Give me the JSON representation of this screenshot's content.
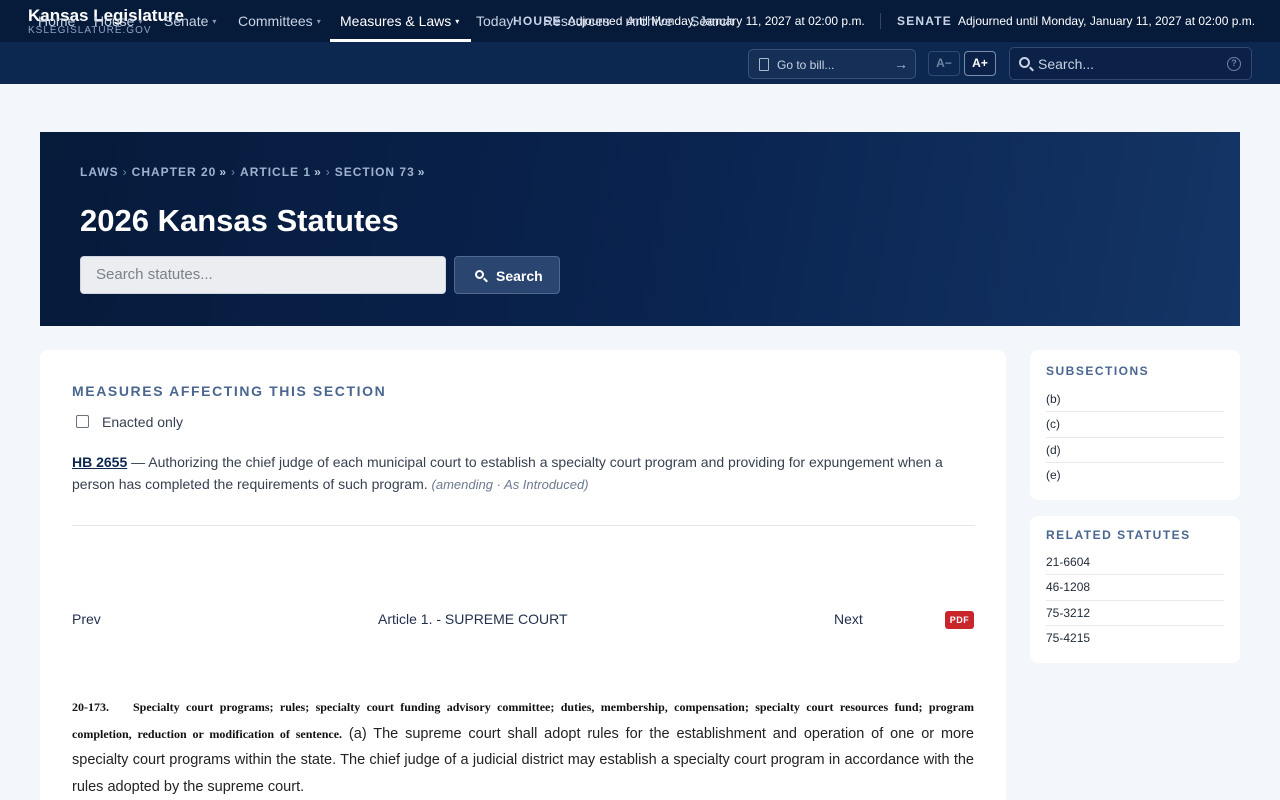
{
  "brand": {
    "title": "Kansas Legislature",
    "subtitle": "KSLEGISLATURE.GOV"
  },
  "status": {
    "house": {
      "name": "HOUSE",
      "text": "Adjourned until Monday, January 11, 2027 at 02:00 p.m."
    },
    "senate": {
      "name": "SENATE",
      "text": "Adjourned until Monday, January 11, 2027 at 02:00 p.m."
    }
  },
  "nav": {
    "items": [
      {
        "label": "Home"
      },
      {
        "label": "House",
        "caret": "▾"
      },
      {
        "label": "Senate",
        "caret": "▾"
      },
      {
        "label": "Committees",
        "caret": "▾"
      },
      {
        "label": "Measures & Laws",
        "caret": "▾",
        "active": true
      },
      {
        "label": "Today",
        "caret": "▾"
      },
      {
        "label": "Resources"
      },
      {
        "label": "Archive"
      },
      {
        "label": "Search"
      }
    ],
    "goto_placeholder": "Go to bill...",
    "goto_arrow": "→",
    "font_decrease": "A−",
    "font_increase": "A+",
    "search_placeholder": "Search...",
    "help": "?"
  },
  "hero": {
    "breadcrumb": [
      {
        "label": "LAWS"
      },
      {
        "label": "CHAPTER 20",
        "dropdown": "»"
      },
      {
        "label": "ARTICLE 1",
        "dropdown": "»"
      },
      {
        "label": "SECTION 73",
        "dropdown": "»"
      }
    ],
    "breadcrumb_sep": "›",
    "title": "2026 Kansas Statutes",
    "search_placeholder": "Search statutes...",
    "search_button": "Search"
  },
  "measures": {
    "heading": "MEASURES AFFECTING THIS SECTION",
    "filter_label": "Enacted only",
    "filter_checked": false,
    "items": [
      {
        "bill": "HB 2655",
        "description": " — Authorizing the chief judge of each municipal court to establish a specialty court program and providing for expungement when a person has completed the requirements of such program. ",
        "status": "(amending · As Introduced)"
      }
    ]
  },
  "pager": {
    "prev": "Prev",
    "article": "Article 1. - SUPREME COURT",
    "next": "Next",
    "pdf": "PDF"
  },
  "statute": {
    "number": "20-173.",
    "catchline": "Specialty court programs; rules; specialty court funding advisory committee; duties, membership, compensation; specialty court resources fund; program completion, reduction or modification of sentence.",
    "text": " (a) The supreme court shall adopt rules for the establishment and operation of one or more specialty court programs within the state. The chief judge of a judicial district may establish a specialty court program in accordance with the rules adopted by the supreme court."
  },
  "subsections": {
    "heading": "SUBSECTIONS",
    "items": [
      "(b)",
      "(c)",
      "(d)",
      "(e)"
    ]
  },
  "related": {
    "heading": "RELATED STATUTES",
    "items": [
      "21-6604",
      "46-1208",
      "75-3212",
      "75-4215"
    ]
  },
  "colors": {
    "topbar": "#061a3a",
    "navbar": "#0d2850",
    "accent": "#4a6691",
    "pdf": "#c8262b",
    "page_bg": "#f3f7fb"
  }
}
